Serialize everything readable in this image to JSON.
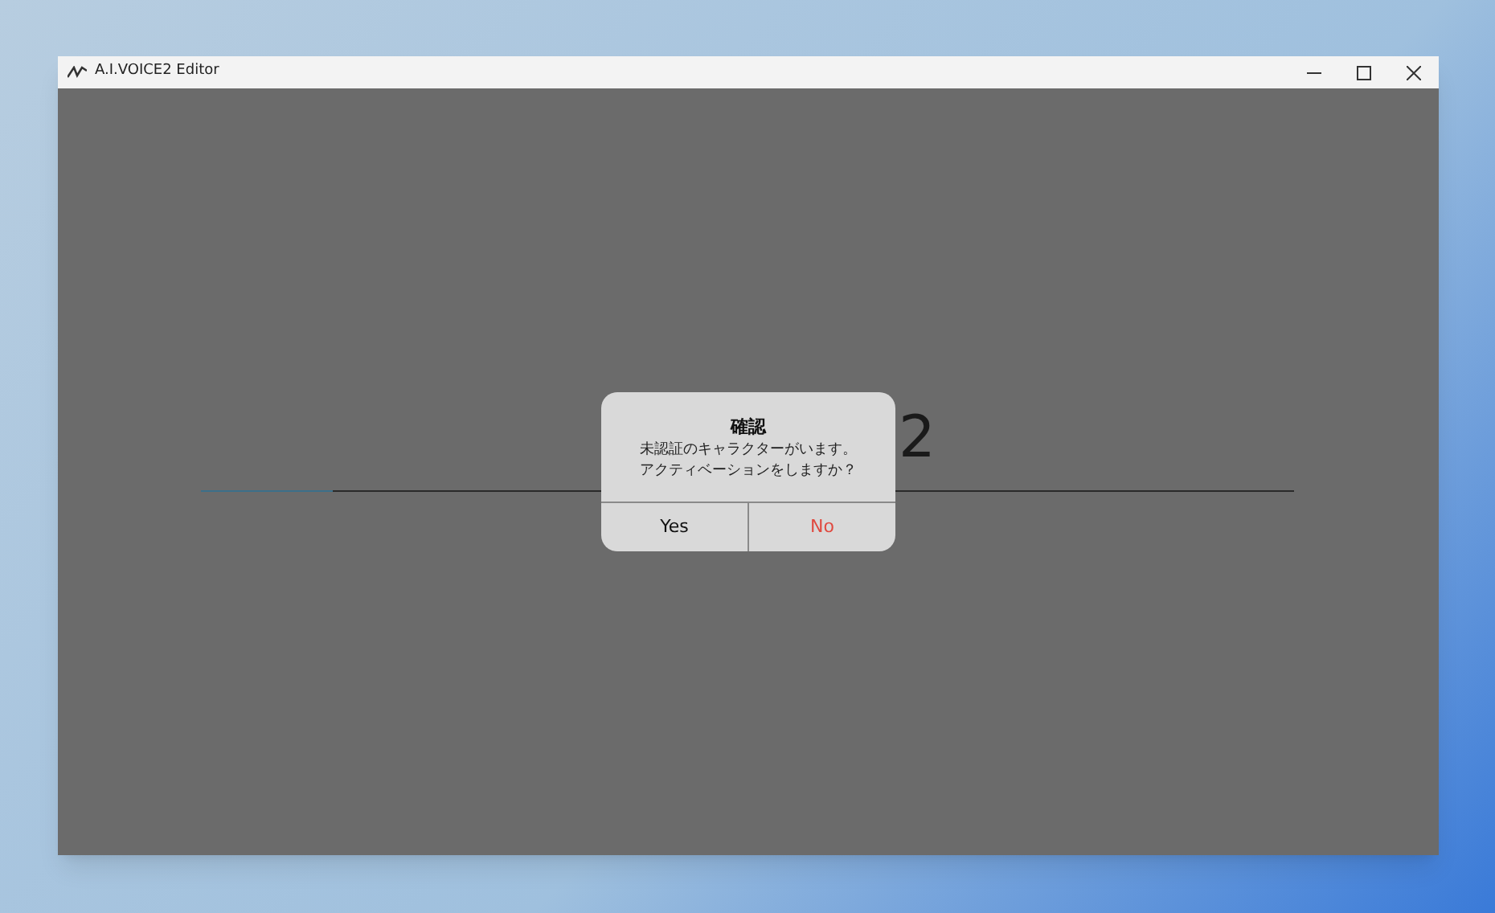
{
  "window": {
    "title": "A.I.VOICE2 Editor"
  },
  "background": {
    "title_right_fragment": "2",
    "progress": {
      "level": 0.12
    }
  },
  "dialog": {
    "title": "確認",
    "message_lines": [
      "未認証のキャラクターがいます。",
      "アクティベーションをしますか？"
    ],
    "buttons": [
      {
        "label": "Yes",
        "kind": "default"
      },
      {
        "label": "No",
        "kind": "danger"
      }
    ]
  }
}
